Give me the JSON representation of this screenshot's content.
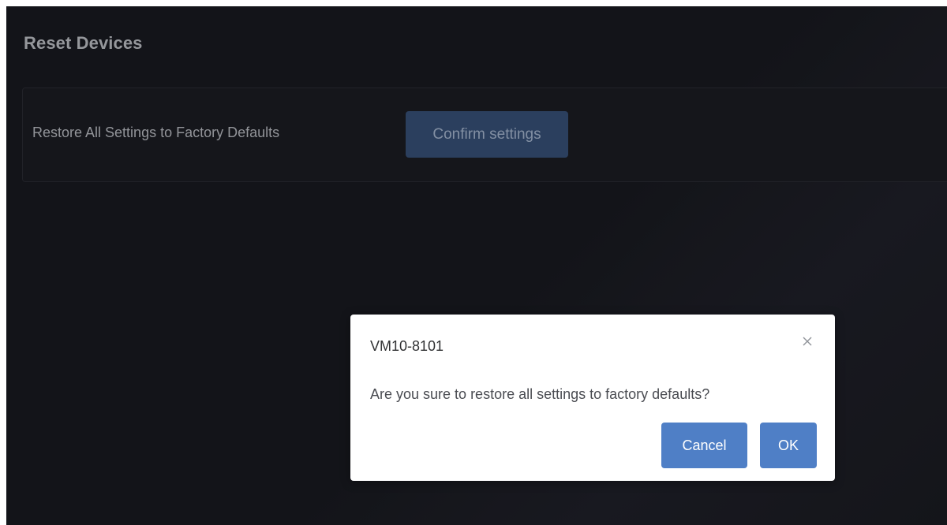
{
  "page": {
    "title": "Reset Devices"
  },
  "reset_card": {
    "label": "Restore All Settings to Factory Defaults",
    "confirm_button": "Confirm settings"
  },
  "dialog": {
    "title": "VM10-8101",
    "close_icon": "close-icon",
    "message": "Are you sure to restore all settings to factory defaults?",
    "cancel_button": "Cancel",
    "ok_button": "OK"
  },
  "colors": {
    "background": "#15161c",
    "primary_button": "#4f7fc6",
    "disabled_button": "#2f4566"
  }
}
